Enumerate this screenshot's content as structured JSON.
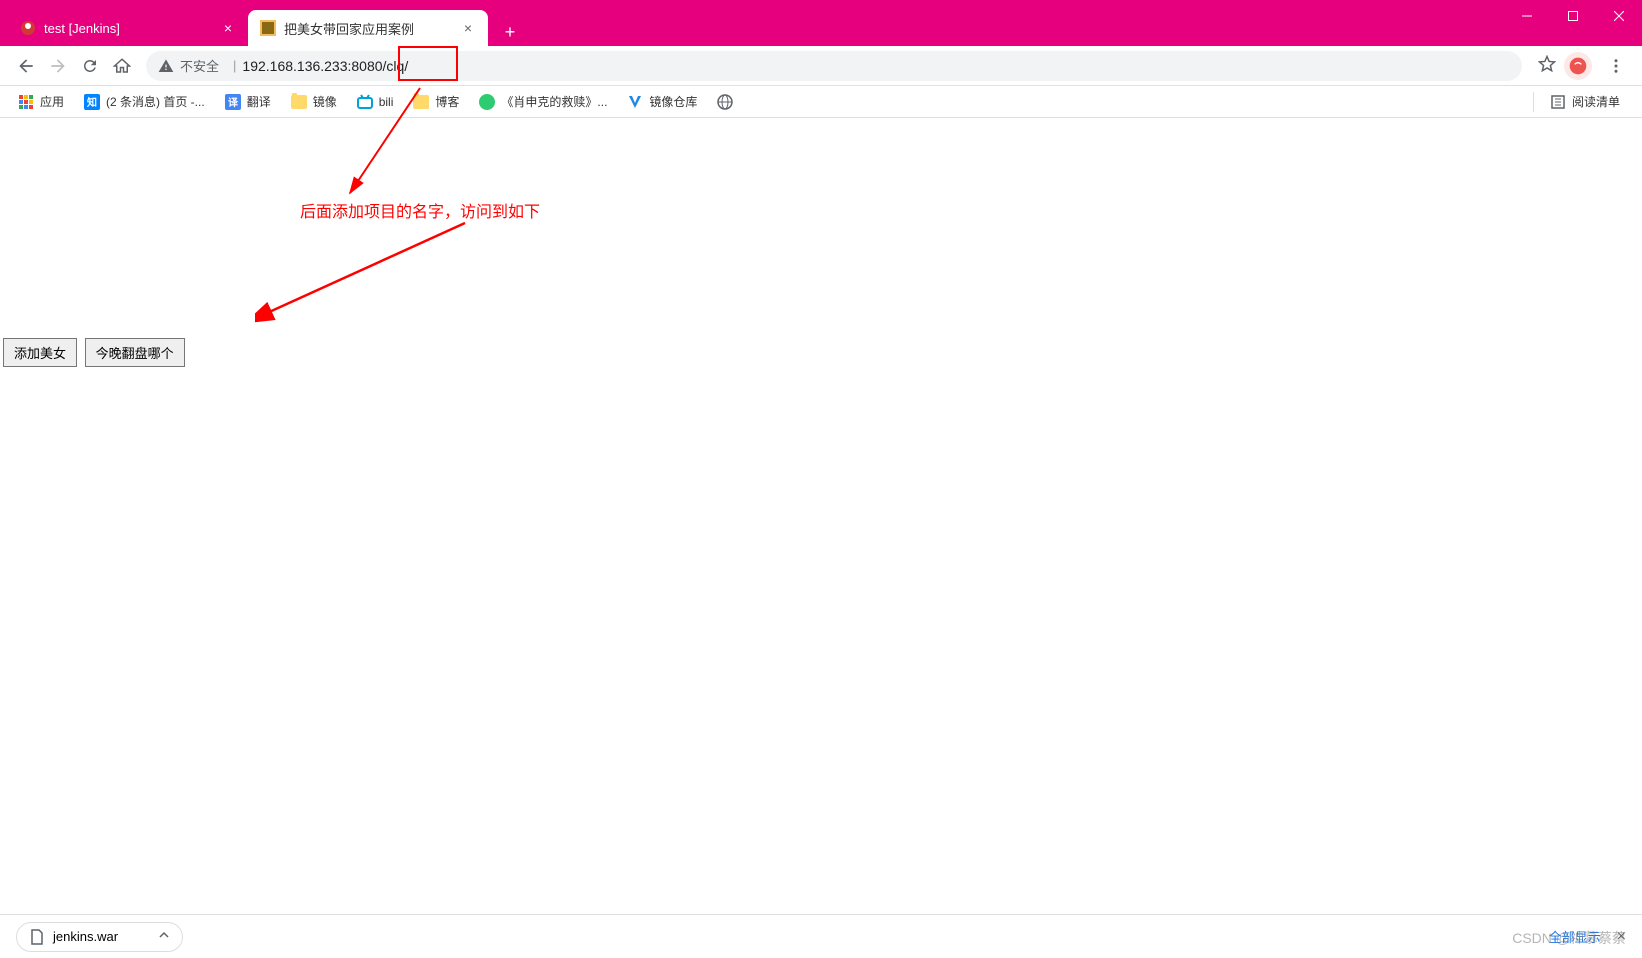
{
  "window": {
    "minimize_title": "Minimize",
    "maximize_title": "Maximize",
    "close_title": "Close"
  },
  "tabs": [
    {
      "title": "test [Jenkins]",
      "active": false
    },
    {
      "title": "把美女带回家应用案例",
      "active": true
    }
  ],
  "toolbar": {
    "security_label": "不安全",
    "url": "192.168.136.233:8080/clq/"
  },
  "bookmarks": [
    {
      "label": "应用",
      "icon": "apps"
    },
    {
      "label": "(2 条消息) 首页 -...",
      "icon": "zhi"
    },
    {
      "label": "翻译",
      "icon": "translate"
    },
    {
      "label": "镜像",
      "icon": "folder"
    },
    {
      "label": "bili",
      "icon": "bili"
    },
    {
      "label": "博客",
      "icon": "folder"
    },
    {
      "label": "《肖申克的救赎》...",
      "icon": "green"
    },
    {
      "label": "镜像仓库",
      "icon": "v"
    },
    {
      "label": "",
      "icon": "globe"
    }
  ],
  "reading_list_label": "阅读清单",
  "page": {
    "buttons": [
      "添加美女",
      "今晚翻盘哪个"
    ]
  },
  "annotation": {
    "text": "后面添加项目的名字，访问到如下"
  },
  "downloads": {
    "item": "jenkins.war",
    "show_all": "全部显示"
  },
  "watermark": "CSDN @神慕蔡蔡"
}
